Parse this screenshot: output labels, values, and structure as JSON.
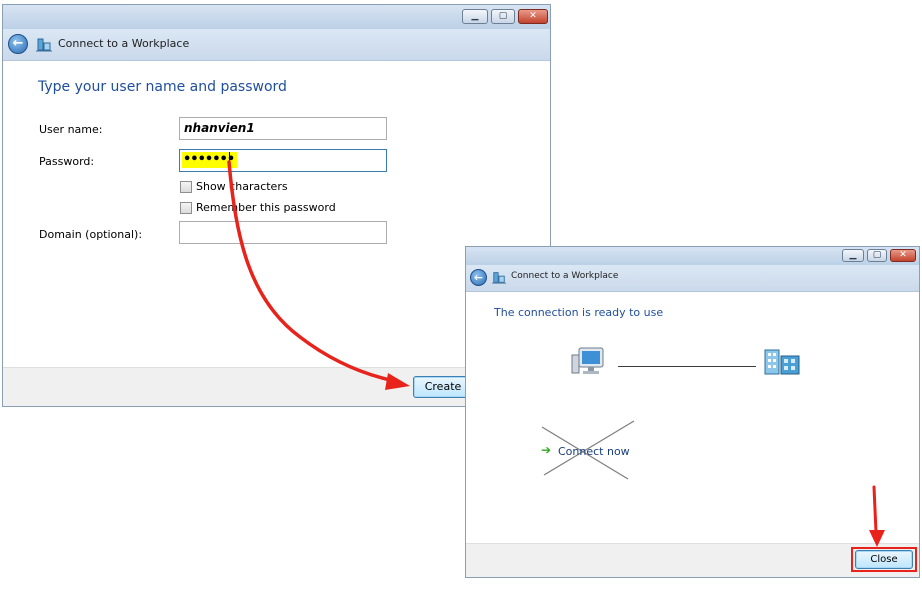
{
  "window1": {
    "title": "Connect to a Workplace",
    "heading": "Type your user name and password",
    "username_label": "User name:",
    "username_value": "nhanvien1",
    "password_label": "Password:",
    "password_value": "•••••••",
    "show_characters_label": "Show characters",
    "remember_password_label": "Remember this password",
    "domain_label": "Domain (optional):",
    "domain_value": "",
    "create_button": "Create"
  },
  "window2": {
    "title": "Connect to a Workplace",
    "heading": "The connection is ready to use",
    "connect_now_label": "Connect now",
    "close_button": "Close"
  },
  "icons": {
    "back": "back-arrow-icon",
    "wizard": "network-wizard-icon",
    "computer": "computer-icon",
    "network": "workplace-network-icon",
    "connect_arrow": "green-arrow-icon"
  },
  "colors": {
    "heading_blue": "#1f4e9c",
    "annotation_red": "#e8231b",
    "password_highlight": "#ffff00",
    "connect_arrow_green": "#2ea81f"
  }
}
